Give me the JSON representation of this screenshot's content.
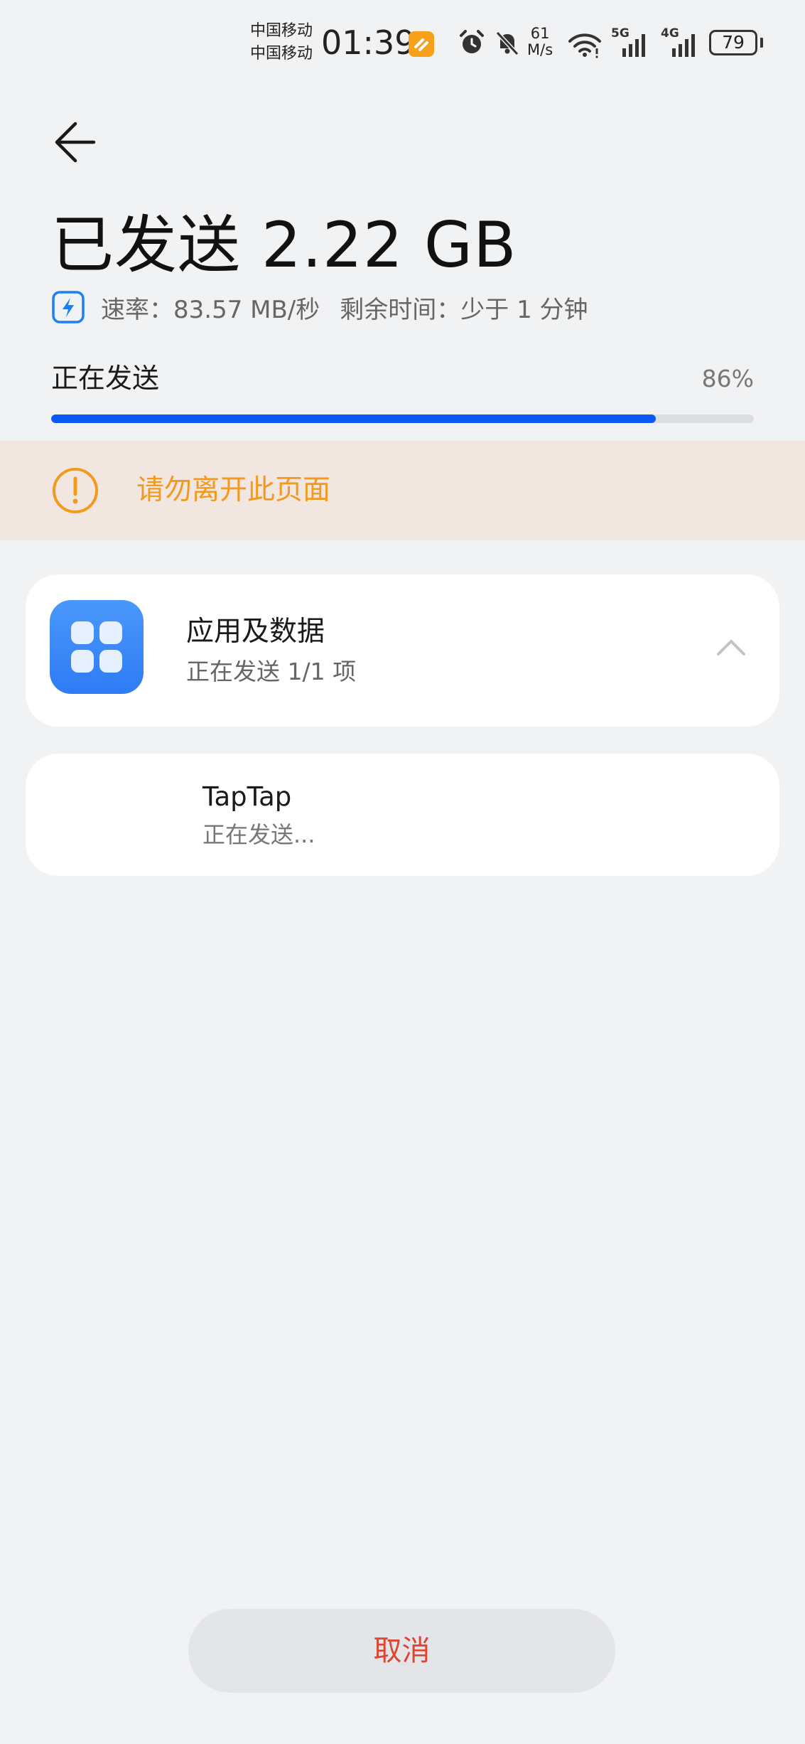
{
  "status_bar": {
    "carrier_1": "中国移动",
    "carrier_2": "中国移动",
    "time": "01:39",
    "net_speed_value": "61",
    "net_speed_unit": "M/s",
    "signal_1": "5G",
    "signal_2": "4G",
    "battery": "79",
    "icons": [
      "notification-app-icon",
      "alarm-icon",
      "bell-muted-icon",
      "wifi-icon",
      "signal-5g-icon",
      "signal-4g-icon",
      "battery-icon"
    ]
  },
  "header": {
    "back_icon": "arrow-left-icon",
    "title": "已发送 2.22 GB",
    "rate_icon": "lightning-icon",
    "rate_text": "速率：83.57 MB/秒",
    "remaining_text": "剩余时间：少于 1 分钟"
  },
  "progress": {
    "label": "正在发送",
    "percent_text": "86%",
    "fraction": 0.86,
    "color": "#0a59f7"
  },
  "warning": {
    "icon": "exclamation-circle-icon",
    "text": "请勿离开此页面",
    "color": "#f39a1e"
  },
  "category_card": {
    "icon": "app-grid-icon",
    "title": "应用及数据",
    "subtitle": "正在发送 1/1 项",
    "toggle_icon": "chevron-up-icon"
  },
  "items": [
    {
      "name": "TapTap",
      "status": "正在发送..."
    }
  ],
  "footer": {
    "cancel_label": "取消",
    "cancel_color": "#e0432f"
  }
}
